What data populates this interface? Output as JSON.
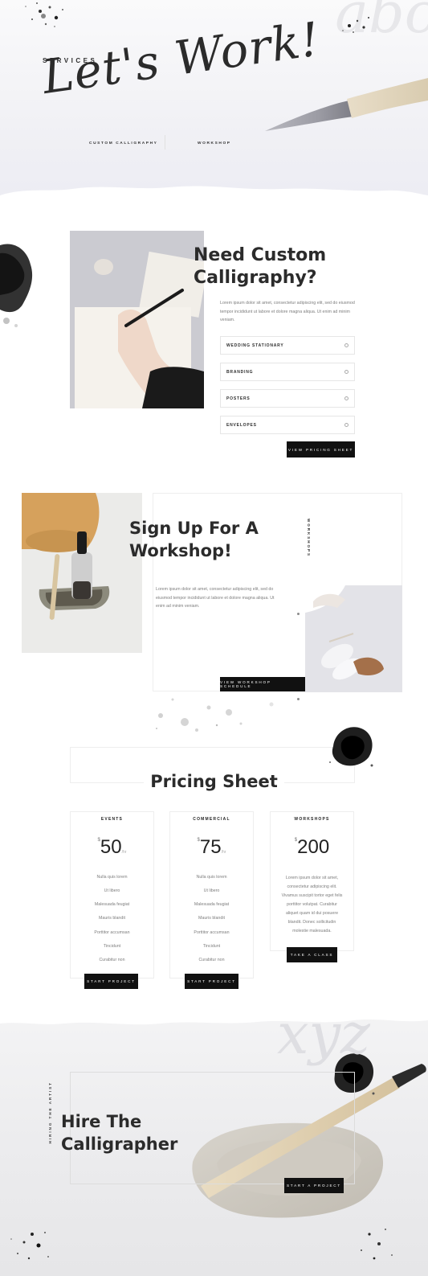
{
  "hero": {
    "eyebrow": "SERVICES",
    "title": "Let's Work!",
    "links": [
      "CUSTOM CALLIGRAPHY",
      "WORKSHOP"
    ],
    "ghost_text": "abc"
  },
  "custom": {
    "title_line1": "Need Custom",
    "title_line2": "Calligraphy?",
    "paragraph": "Lorem ipsum dolor sit amet, consectetur adipiscing elit, sed do eiusmod tempor incididunt ut labore et dolore magna aliqua. Ut enim ad minim veniam.",
    "accordion": [
      "WEDDING STATIONARY",
      "BRANDING",
      "POSTERS",
      "ENVELOPES"
    ],
    "button": "VIEW PRICING SHEET"
  },
  "workshop": {
    "title_line1": "Sign Up For A",
    "title_line2": "Workshop!",
    "vertical_label": "WORKSHOPS",
    "paragraph": "Lorem ipsum dolor sit amet, consectetur adipiscing elit, sed do eiusmod tempor incididunt ut labore et dolore magna aliqua. Ut enim ad minim veniam.",
    "button": "VIEW WORKSHOP SCHEDULE"
  },
  "pricing": {
    "title": "Pricing Sheet",
    "cards": [
      {
        "name": "EVENTS",
        "currency": "$",
        "amount": "50",
        "per": "/hr",
        "features": [
          "Nulla quis lorem",
          "Ut libero",
          "Malesuada feugiat",
          "Mauris blandit",
          "Porttitor accumsan",
          "Tincidunt",
          "Curabitur non"
        ],
        "button": "START PROJECT"
      },
      {
        "name": "COMMERCIAL",
        "currency": "$",
        "amount": "75",
        "per": "/hr",
        "features": [
          "Nulla quis lorem",
          "Ut libero",
          "Malesuada feugiat",
          "Mauris blandit",
          "Porttitor accumsan",
          "Tincidunt",
          "Curabitur non"
        ],
        "button": "START PROJECT"
      },
      {
        "name": "WORKSHOPS",
        "currency": "$",
        "amount": "200",
        "description": [
          "Lorem ipsum dolor sit amet,",
          "consectetur adipiscing elit.",
          "Vivamus suscipit tortor eget felis",
          "porttitor volutpat. Curabitur",
          "aliquet quam id dui posuere",
          "blandit. Donec sollicitudin",
          "molestie malesuada."
        ],
        "button": "TAKE A CLASS"
      }
    ]
  },
  "hire": {
    "vertical_label": "HIRING THE ARTIST",
    "title_line1": "Hire The",
    "title_line2": "Calligrapher",
    "button": "START A PROJECT",
    "ghost_text": "xyz"
  }
}
